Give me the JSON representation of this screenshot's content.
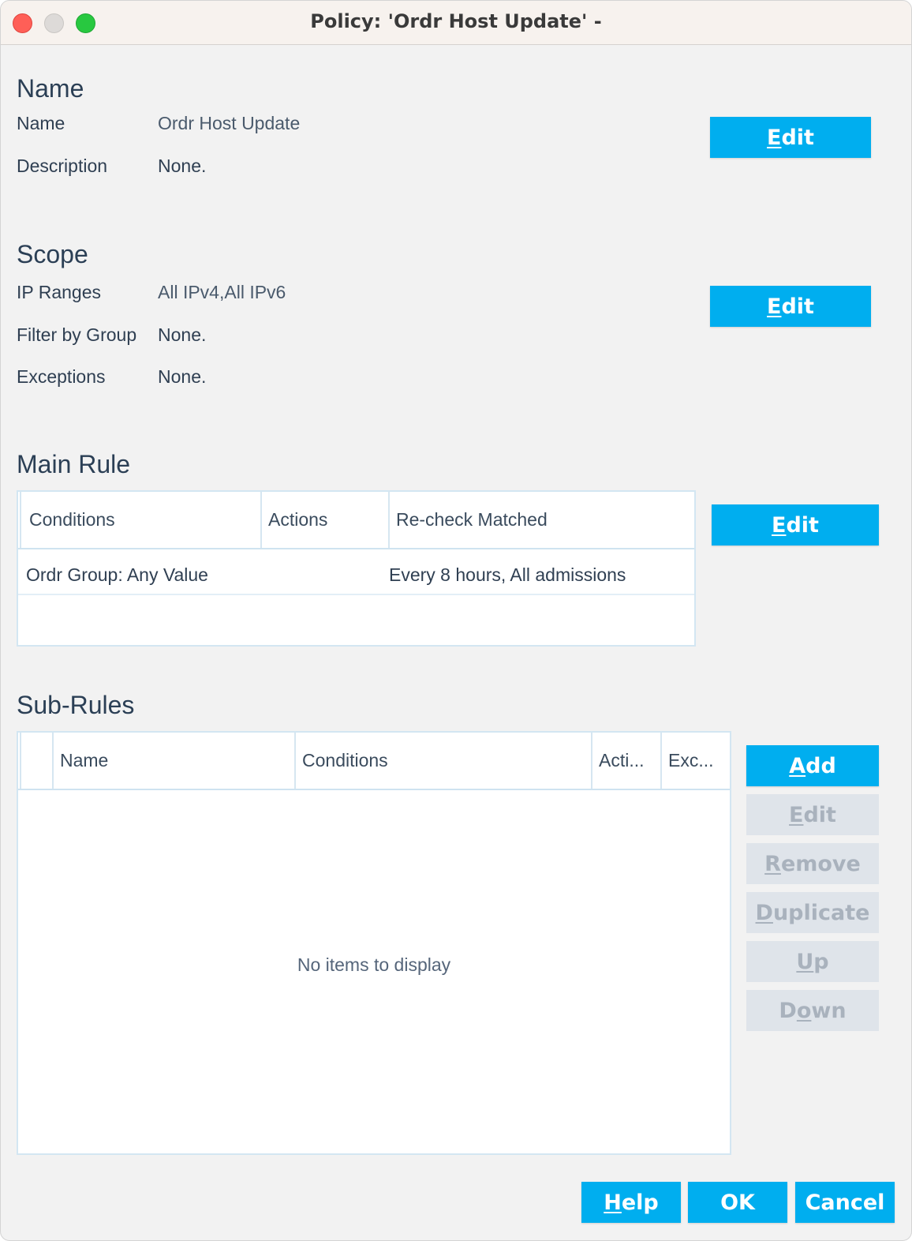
{
  "window": {
    "title": "Policy: 'Ordr Host Update' -"
  },
  "name_section": {
    "heading": "Name",
    "fields": [
      {
        "label": "Name",
        "value": "Ordr Host Update"
      },
      {
        "label": "Description",
        "value": "None."
      }
    ],
    "edit_label": "Edit",
    "edit_mnemonic": "E",
    "edit_rest": "dit"
  },
  "scope_section": {
    "heading": "Scope",
    "fields": [
      {
        "label": "IP Ranges",
        "value": "All IPv4,All IPv6"
      },
      {
        "label": "Filter by Group",
        "value": "None."
      },
      {
        "label": "Exceptions",
        "value": "None."
      }
    ],
    "edit_mnemonic": "E",
    "edit_rest": "dit"
  },
  "main_rule": {
    "heading": "Main Rule",
    "columns": [
      "Conditions",
      "Actions",
      "Re-check Matched"
    ],
    "rows": [
      {
        "conditions": "Ordr Group: Any Value",
        "actions": "",
        "recheck": "Every 8 hours, All admissions"
      }
    ],
    "edit_mnemonic": "E",
    "edit_rest": "dit"
  },
  "sub_rules": {
    "heading": "Sub-Rules",
    "columns": [
      "",
      "Name",
      "Conditions",
      "Acti...",
      "Exc..."
    ],
    "empty_message": "No items to display",
    "buttons": [
      {
        "mnemonic": "A",
        "rest": "dd",
        "enabled": true
      },
      {
        "mnemonic": "E",
        "rest": "dit",
        "enabled": false
      },
      {
        "mnemonic": "R",
        "rest": "emove",
        "enabled": false
      },
      {
        "mnemonic": "D",
        "rest": "uplicate",
        "enabled": false
      },
      {
        "mnemonic": "U",
        "rest": "p",
        "enabled": false
      },
      {
        "pre": "D",
        "mnemonic": "o",
        "rest": "wn",
        "enabled": false
      }
    ]
  },
  "footer": {
    "help": {
      "mnemonic": "H",
      "rest": "elp"
    },
    "ok": "OK",
    "cancel": "Cancel"
  },
  "colors": {
    "accent": "#00aeef",
    "disabled_button": "#dfe4ea",
    "window_bg": "#f2f2f2"
  }
}
